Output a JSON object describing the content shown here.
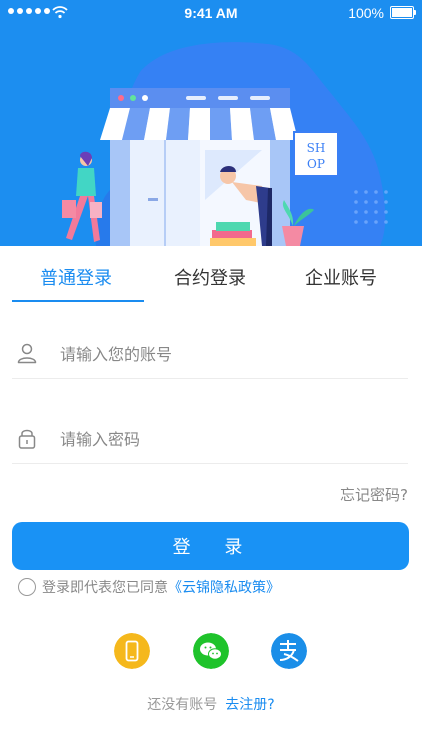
{
  "status_bar": {
    "time": "9:41 AM",
    "battery": "100%"
  },
  "hero": {
    "shop_sign": [
      "SH",
      "OP"
    ]
  },
  "tabs": [
    {
      "label": "普通登录"
    },
    {
      "label": "合约登录"
    },
    {
      "label": "企业账号"
    }
  ],
  "form": {
    "account_placeholder": "请输入您的账号",
    "password_placeholder": "请输入密码",
    "forgot_label": "忘记密码?",
    "login_label": "登 录",
    "agree_text": "登录即代表您已同意",
    "agree_link": "《云锦隐私政策》"
  },
  "social": [
    "phone-login",
    "wechat-login",
    "alipay-login"
  ],
  "register": {
    "prompt": "还没有账号",
    "link": "去注册?"
  },
  "colors": {
    "accent": "#1a8cf0",
    "hero_bg": "#1c8ef0",
    "phone": "#f5b81c",
    "wechat": "#1fc32b",
    "alipay": "#1a8ee8"
  }
}
